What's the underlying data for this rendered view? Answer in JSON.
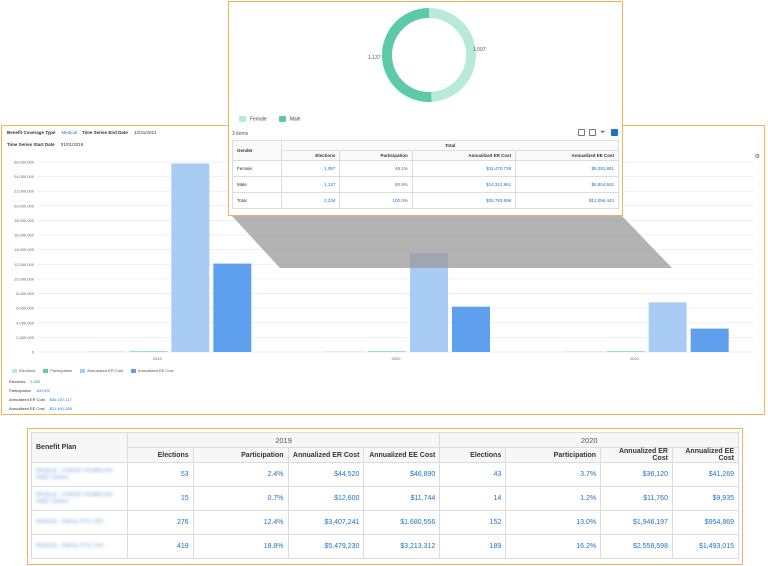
{
  "chart_panel": {
    "filters": [
      {
        "label": "Benefit Coverage Type",
        "value": "Medical"
      },
      {
        "label": "Time Series End Date",
        "value": "12/31/2021"
      },
      {
        "label": "Time Series Start Date",
        "value": "01/01/2019"
      }
    ],
    "legend": [
      {
        "label": "Elections",
        "color": "#b8ead9"
      },
      {
        "label": "Participation",
        "color": "#5cc9a7"
      },
      {
        "label": "Annualized ER Cost",
        "color": "#a9ccf5"
      },
      {
        "label": "Annualized EE Cost",
        "color": "#5ea0ee"
      }
    ],
    "summary": [
      {
        "label": "Elections",
        "value": "2,432"
      },
      {
        "label": "Participation",
        "value": "100.0%"
      },
      {
        "label": "Annualized ER Cost",
        "value": "$46,157,117"
      },
      {
        "label": "Annualized EE Cost",
        "value": "$21,491,289"
      }
    ]
  },
  "chart_data": {
    "type": "bar",
    "categories": [
      "2019",
      "2020",
      "2021"
    ],
    "series": [
      {
        "name": "Elections",
        "values": [
          0,
          0,
          0
        ],
        "color": "#b8ead9"
      },
      {
        "name": "Participation",
        "values": [
          0,
          0,
          0
        ],
        "color": "#5cc9a7"
      },
      {
        "name": "Annualized ER Cost",
        "values": [
          25800000,
          13500000,
          6800000
        ],
        "color": "#a9ccf5"
      },
      {
        "name": "Annualized EE Cost",
        "values": [
          12100000,
          6200000,
          3200000
        ],
        "color": "#5ea0ee"
      }
    ],
    "yticks": [
      "0",
      "2,000,000",
      "4,000,000",
      "6,000,000",
      "8,000,000",
      "10,000,000",
      "12,000,000",
      "14,000,000",
      "16,000,000",
      "18,000,000",
      "20,000,000",
      "22,000,000",
      "24,000,000",
      "26,000,000"
    ],
    "ylim": [
      0,
      26000000
    ],
    "grid": true,
    "legend_position": "bottom-left"
  },
  "donut": {
    "segments": [
      {
        "label": "Female",
        "value": 1097,
        "color": "#b8ead9"
      },
      {
        "label": "Male",
        "value": 1137,
        "color": "#5cc9a7"
      }
    ],
    "label_left": "1,137",
    "label_right": "1,097",
    "items_count": "3 items",
    "table": {
      "group_header": "Total",
      "row_header": "Gender",
      "columns": [
        "Elections",
        "Participation",
        "Annualized ER Cost",
        "Annualized EE Cost"
      ],
      "rows": [
        {
          "name": "Female",
          "cells": [
            "1,097",
            "49.1%",
            "$11,470,739",
            "$5,291,881"
          ]
        },
        {
          "name": "Male",
          "cells": [
            "1,137",
            "50.9%",
            "$14,312,961",
            "$6,804,562"
          ]
        },
        {
          "name": "Total",
          "cells": [
            "2,234",
            "100.0%",
            "$25,783,699",
            "$12,096,443"
          ]
        }
      ]
    }
  },
  "bottom_table": {
    "row_header": "Benefit Plan",
    "groups": [
      "2019",
      "2020"
    ],
    "columns": [
      "Elections",
      "Participation",
      "Annualized ER Cost",
      "Annualized EE Cost",
      "Elections",
      "Participation",
      "Annualized ER Cost",
      "Annualized EE Cost"
    ],
    "rows": [
      {
        "plan": "Medical - Anthem Healthcare HMO Select",
        "cells": [
          "53",
          "2.4%",
          "$44,520",
          "$46,890",
          "43",
          "3.7%",
          "$36,120",
          "$41,269"
        ]
      },
      {
        "plan": "Medical - Anthem Healthcare HMO Select",
        "cells": [
          "15",
          "0.7%",
          "$12,600",
          "$11,744",
          "14",
          "1.2%",
          "$11,760",
          "$9,935"
        ]
      },
      {
        "plan": "Medical - Aetna PPO 500",
        "cells": [
          "276",
          "12.4%",
          "$3,407,241",
          "$1,680,556",
          "152",
          "13.0%",
          "$1,946,197",
          "$954,869"
        ]
      },
      {
        "plan": "Medical - Aetna PPO 250",
        "cells": [
          "419",
          "18.8%",
          "$5,479,230",
          "$3,213,312",
          "189",
          "16.2%",
          "$2,558,598",
          "$1,493,015"
        ]
      }
    ]
  }
}
